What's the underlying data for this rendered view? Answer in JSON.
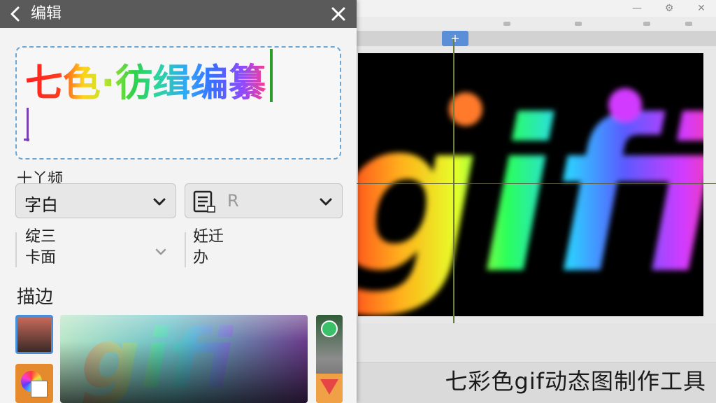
{
  "panel": {
    "title": "编辑",
    "text_line1": "七色·彷缉编纂",
    "font_label": "十丫频",
    "font_dropdown": "字白",
    "layout_dropdown": "R",
    "mini_left_line1": "绽三",
    "mini_left_line2": "卡面",
    "mini_right_line1": "妊迁",
    "mini_right_line2": "办",
    "stroke_label": "描边"
  },
  "editor": {
    "canvas_text": "gifi"
  },
  "caption": "七彩色gif动态图制作工具",
  "colors": {
    "header_bg": "#5a5a5a",
    "accent_blue": "#4a8ed8",
    "caret_green": "#2a9d2a",
    "slider_knob": "#3bc06a",
    "picker_orange": "#e68a2e"
  }
}
